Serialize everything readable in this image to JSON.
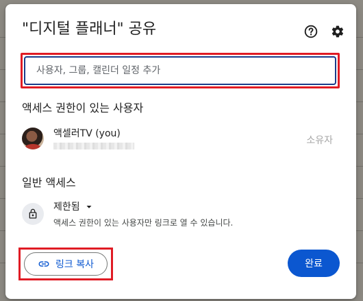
{
  "dialog": {
    "title": "\"디지털 플래너\" 공유",
    "help_icon": "help-circle-icon",
    "settings_icon": "gear-icon"
  },
  "share_input": {
    "placeholder": "사용자, 그룹, 캘린더 일정 추가",
    "value": ""
  },
  "people_section": {
    "title": "액세스 권한이 있는 사용자",
    "people": [
      {
        "name": "액셀러TV (you)",
        "role": "소유자",
        "avatar_icon": "user-photo-avatar"
      }
    ]
  },
  "general_access": {
    "title": "일반 액세스",
    "icon": "lock-icon",
    "selected": "제한됨",
    "description": "액세스 권한이 있는 사용자만 링크로 열 수 있습니다."
  },
  "footer": {
    "copy_link_label": "링크 복사",
    "copy_link_icon": "link-icon",
    "done_label": "완료"
  },
  "colors": {
    "primary": "#0b57d0",
    "highlight_border": "#e01b24",
    "text": "#1f1f1f",
    "muted_text": "#444746"
  }
}
